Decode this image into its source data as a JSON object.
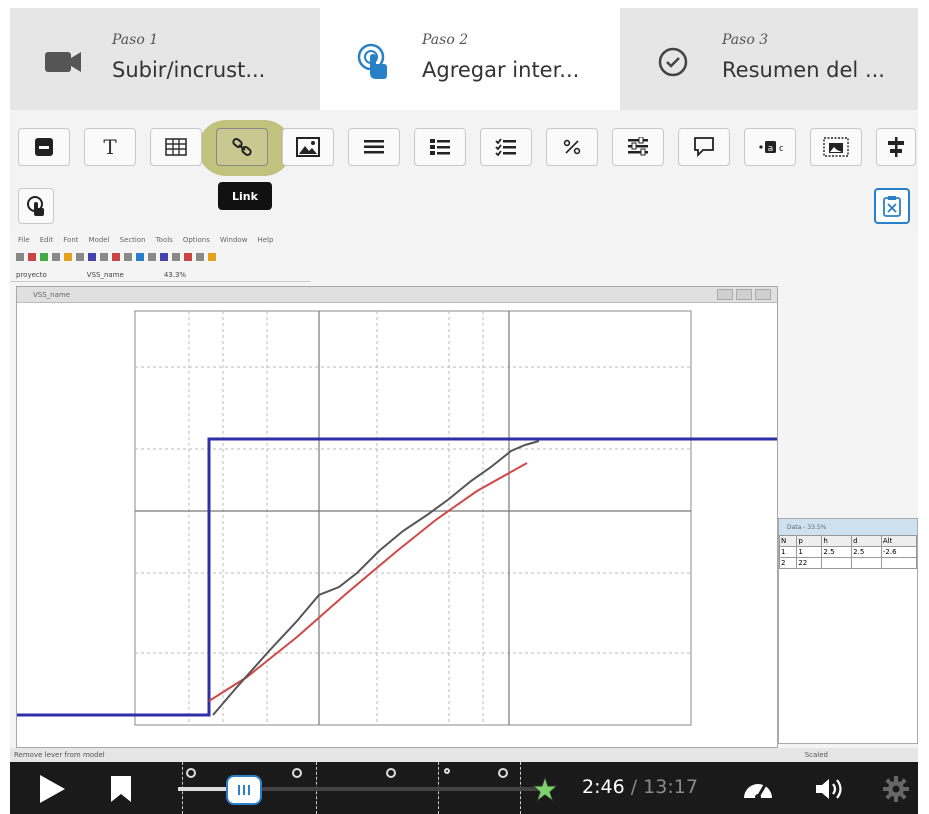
{
  "steps": [
    {
      "label": "Paso 1",
      "title": "Subir/incrust...",
      "icon": "video-camera-icon"
    },
    {
      "label": "Paso 2",
      "title": "Agregar inter...",
      "icon": "touch-hand-icon"
    },
    {
      "label": "Paso 3",
      "title": "Resumen del ...",
      "icon": "check-circle-icon"
    }
  ],
  "toolbar": {
    "text_btn": "T",
    "tooltip": "Link",
    "quiz_btn": "·?·",
    "fraction_btn": "⁄"
  },
  "app": {
    "menu": [
      "File",
      "Edit",
      "Font",
      "Model",
      "Section",
      "Tools",
      "Options",
      "Window",
      "Help"
    ],
    "path": [
      "proyecto",
      "VSS_name",
      "43.3%"
    ],
    "window_title": "VSS_name",
    "status": "Remove lever from model",
    "scaled": "Scaled"
  },
  "table": {
    "title": "Data - 33.5%",
    "headers": [
      "N",
      "p",
      "h",
      "d",
      "Alt"
    ],
    "rows": [
      [
        "1",
        "1",
        "2.5",
        "2.5",
        "-2.6"
      ],
      [
        "2",
        "22",
        "",
        "",
        ""
      ]
    ]
  },
  "player": {
    "current": "2:46",
    "separator": " / ",
    "total": "13:17"
  },
  "colors": {
    "accent": "#2a80c8",
    "highlight": "#b8b86a",
    "series_blue": "#2e2ea8",
    "series_red": "#d04848",
    "series_black": "#444444"
  }
}
